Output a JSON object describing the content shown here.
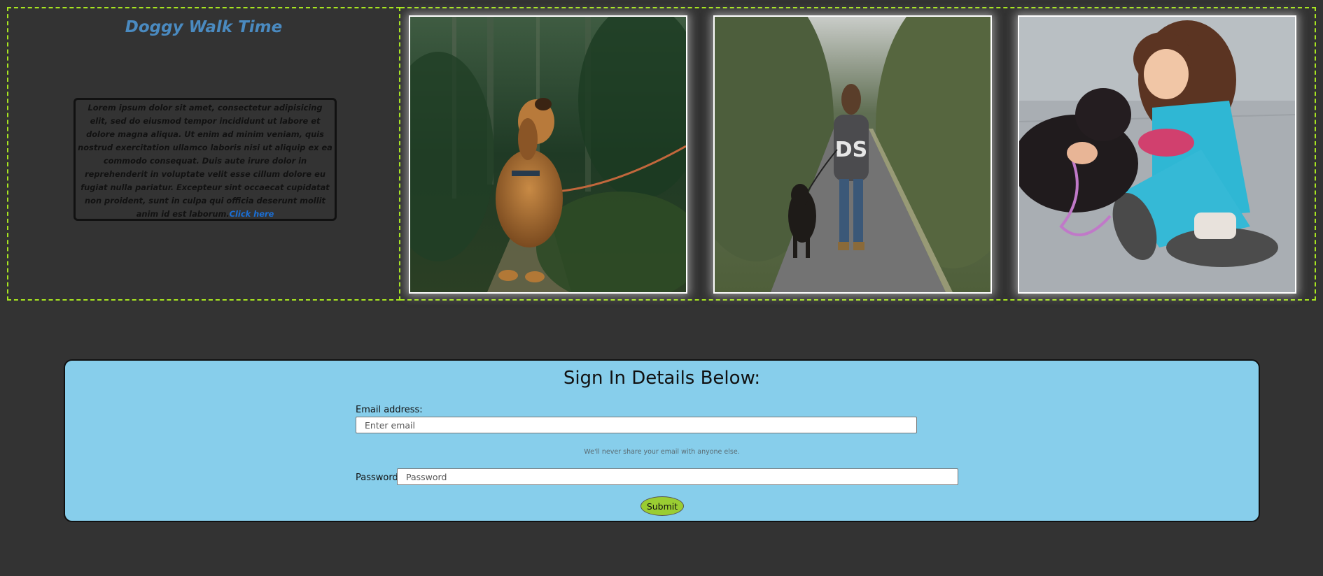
{
  "intro": {
    "title": "Doggy Walk Time",
    "body": "Lorem ipsum dolor sit amet, consectetur adipisicing elit, sed do eiusmod tempor incididunt ut labore et dolore magna aliqua. Ut enim ad minim veniam, quis nostrud exercitation ullamco laboris nisi ut aliquip ex ea commodo consequat. Duis aute irure dolor in reprehenderit in voluptate velit esse cillum dolore eu fugiat nulla pariatur. Excepteur sint occaecat cupidatat non proident, sunt in culpa qui officia deserunt mollit anim id est laborum.",
    "link_label": "Click here"
  },
  "gallery": {
    "photos": [
      {
        "subject": "golden dog sitting on leash in forest"
      },
      {
        "subject": "person walking dog on wooded path",
        "shirt_text": "DS"
      },
      {
        "subject": "girl kissing black puppy"
      }
    ]
  },
  "signin": {
    "heading": "Sign In Details Below:",
    "email_label": "Email address:",
    "email_placeholder": "Enter email",
    "email_hint": "We'll never share your email with anyone else.",
    "password_label": "Password:",
    "password_placeholder": "Password",
    "submit_label": "Submit"
  },
  "colors": {
    "page_background": "#333333",
    "panel_border": "#a8e620",
    "title": "#4a8ac0",
    "link": "#1a6fd6",
    "signin_background": "#87ceeb",
    "submit_background": "#9acd32"
  }
}
